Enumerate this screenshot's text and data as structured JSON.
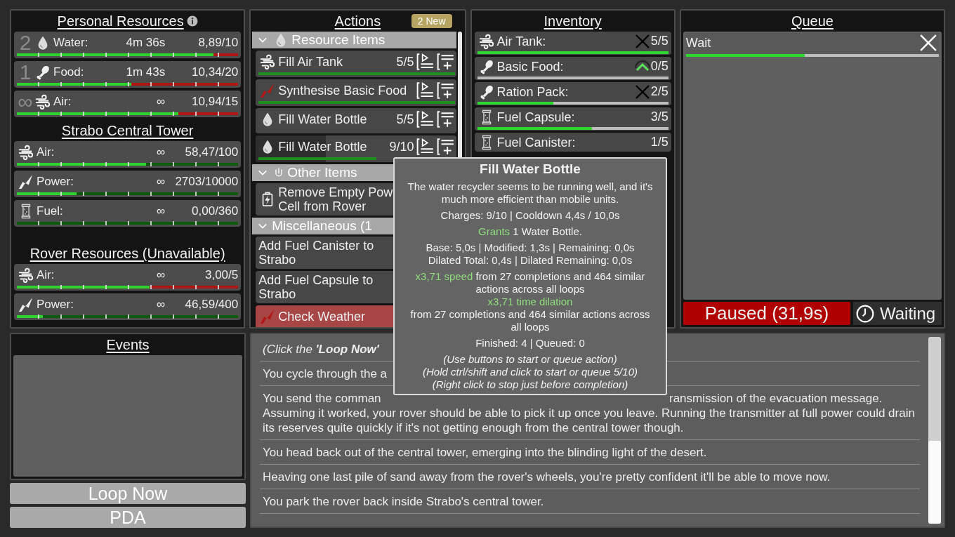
{
  "resources": [
    {
      "title": "Personal Resources",
      "info": true,
      "rows": [
        {
          "count": "2",
          "kind": "water",
          "label": "Water:",
          "time": "4m 36s",
          "value": "8,89/10",
          "level": 0.889,
          "warning": true
        },
        {
          "count": "1",
          "kind": "food",
          "label": "Food:",
          "time": "1m 43s",
          "value": "10,34/20",
          "level": 0.517,
          "warning": true
        },
        {
          "count": "∞",
          "kind": "air",
          "label": "Air:",
          "time": "∞",
          "value": "10,94/15",
          "level": 0.73,
          "warning": true
        }
      ]
    },
    {
      "title": "Strabo Central Tower",
      "rows": [
        {
          "kind": "air",
          "label": "Air:",
          "time": "∞",
          "value": "58,47/100",
          "level": 0.585,
          "warning": false
        },
        {
          "kind": "power",
          "label": "Power:",
          "time": "∞",
          "value": "2703/10000",
          "level": 0.27,
          "warning": false
        },
        {
          "kind": "fuel",
          "label": "Fuel:",
          "time": "∞",
          "value": "0,00/360",
          "warning": false
        }
      ]
    },
    {
      "title": "Rover Resources (Unavailable)",
      "rows": [
        {
          "kind": "air",
          "label": "Air:",
          "time": "∞",
          "value": "3,00/5",
          "level": 0.6,
          "warning": true
        },
        {
          "kind": "power",
          "label": "Power:",
          "time": "∞",
          "value": "46,59/400",
          "level": 0.116,
          "warning": false
        }
      ]
    }
  ],
  "events": {
    "title": "Events"
  },
  "buttons": [
    "Loop Now",
    "PDA"
  ],
  "actions": {
    "title": "Actions",
    "badge": "2 New",
    "categories": [
      {
        "label": "Resource Items",
        "kind": "water",
        "expanded": true,
        "items": [
          {
            "kind": "air",
            "label": "Fill Air Tank",
            "charges": "5/5",
            "level": 1,
            "controls": true
          },
          {
            "kind": "power",
            "label": "Synthesise Basic Food",
            "lacking": true,
            "level": 1,
            "controls": true
          },
          {
            "kind": "water",
            "label": "Fill Water Bottle",
            "charges": "5/5",
            "controls": true
          },
          {
            "kind": "water",
            "label": "Fill Water Bottle",
            "charges": "9/10",
            "level": 0.6,
            "cooldown": {
              "level": 0.35
            },
            "controls": true
          }
        ]
      },
      {
        "label": "Other Items",
        "kind": "plug",
        "expanded": true,
        "items": [
          {
            "kind": "battery",
            "label": "Remove Empty Pow\nCell from Rover"
          }
        ]
      },
      {
        "label": "Miscellaneous (1",
        "expanded": true,
        "items": [
          {
            "label": "Add Fuel Canister to\nStrabo"
          },
          {
            "label": "Add Fuel Capsule to\nStrabo"
          },
          {
            "kind": "power",
            "label": "Check Weather",
            "lacking": true,
            "alert": true
          }
        ]
      }
    ]
  },
  "inventory": {
    "title": "Inventory",
    "items": [
      {
        "kind": "air",
        "label": "Air Tank:",
        "capped": true,
        "count": "5/5",
        "bar": true,
        "level": 1
      },
      {
        "kind": "food",
        "label": "Basic Food:",
        "wanted": true,
        "count": "0/5",
        "bar": true
      },
      {
        "kind": "food",
        "label": "Ration Pack:",
        "capped": true,
        "count": "2/5",
        "bar": true,
        "level": 0.4
      },
      {
        "kind": "fuel",
        "label": "Fuel Capsule:",
        "count": "3/5",
        "bar": true,
        "level": 0.6
      },
      {
        "kind": "fuel",
        "label": "Fuel Canister:",
        "count": "1/5"
      }
    ]
  },
  "queue": {
    "title": "Queue",
    "items": [
      {
        "label": "Wait",
        "level": 0.47
      }
    ],
    "status": {
      "label": "Paused (31,9s)",
      "paused": true
    },
    "state": "Waiting"
  },
  "tooltip": {
    "title": "Fill Water Bottle",
    "blocks": [
      {
        "lines": [
          [
            {
              "text": "The water recycler seems to be running well, and it's"
            }
          ],
          [
            {
              "text": "much more efficient than mobile units."
            }
          ]
        ]
      },
      {
        "lines": [
          [
            {
              "text": "Charges: 9/10 | Cooldown 4,4s / 10,0s"
            }
          ]
        ]
      },
      {
        "lines": [
          [
            {
              "text": "Grants",
              "highlight": true
            },
            {
              "text": "1 Water Bottle."
            }
          ]
        ]
      },
      {
        "lines": [
          [
            {
              "text": "Base: 5,0s | Modified: 1,3s | Remaining: 0,0s"
            }
          ],
          [
            {
              "text": "Dilated Total: 0,4s | Dilated Remaining: 0,0s"
            }
          ]
        ]
      },
      {
        "lines": [
          [
            {
              "text": "x3,71 speed",
              "highlight": true
            },
            {
              "text": "from 27 completions and 464 similar"
            }
          ],
          [
            {
              "text": "actions across all loops"
            }
          ],
          [
            {
              "text": "x3,71 time dilation",
              "highlight": true
            }
          ],
          [
            {
              "text": "from 27 completions and 464 similar actions across"
            }
          ],
          [
            {
              "text": "all loops"
            }
          ]
        ]
      },
      {
        "lines": [
          [
            {
              "text": "Finished: 4 | Queued: 0"
            }
          ]
        ]
      },
      {
        "italic": true,
        "lines": [
          [
            {
              "text": "(Use buttons to start or queue action)"
            }
          ],
          [
            {
              "text": "(Hold ctrl/shift and click to start or queue 5/10)"
            }
          ],
          [
            {
              "text": "(Right click to stop just before completion)"
            }
          ]
        ]
      }
    ]
  },
  "log": [
    {
      "italic": true,
      "text": "(Click the **'Loop Now'**"
    },
    {
      "italic": false,
      "text": "You cycle through the a"
    },
    {
      "italic": false,
      "text": "You send the comman",
      "tail": "ransmission of the evacuation message.",
      "more": "Assuming it worked, your rover should be able to pick it up once you leave. Running the transmitter at full power could drain its reserves quite quickly if it's not getting enough from the central tower though."
    },
    {
      "italic": false,
      "text": "You head back out of the central tower, emerging into the blinding light of the desert."
    },
    {
      "italic": false,
      "text": "Heaving one last pile of sand away from the rover's wheels, you're pretty confident it'll be able to move now."
    },
    {
      "italic": false,
      "text": "You park the rover back inside Strabo's central tower."
    }
  ]
}
